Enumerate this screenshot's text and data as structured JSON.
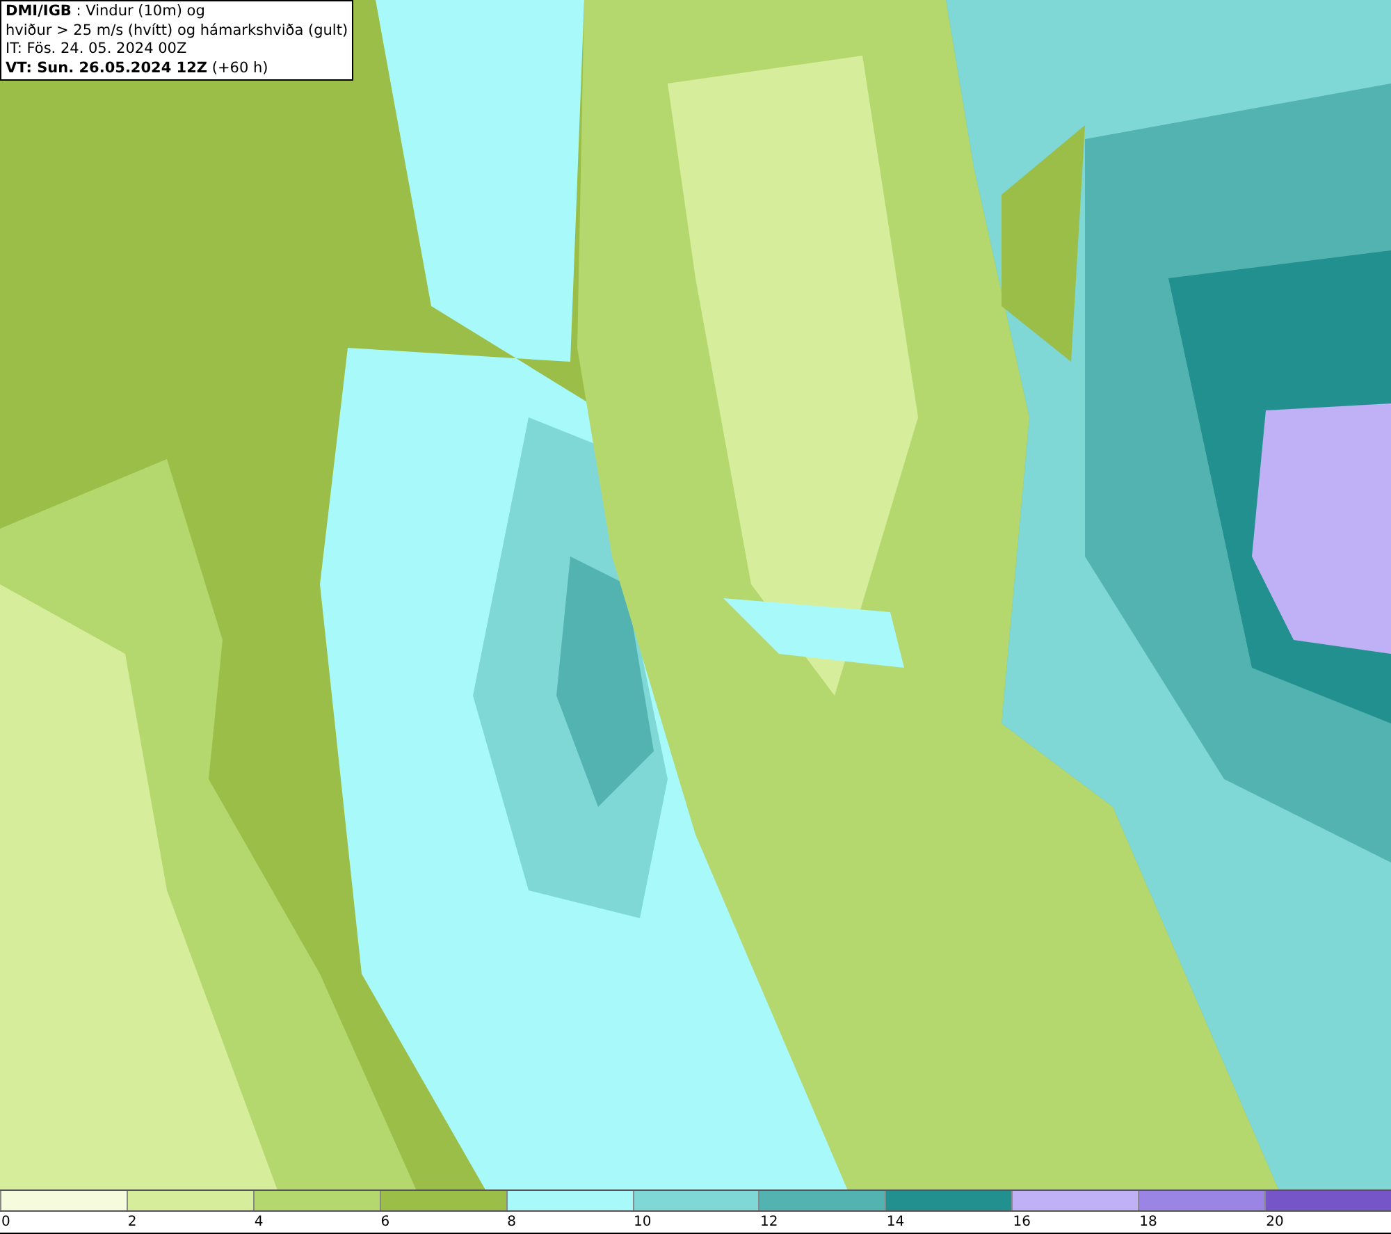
{
  "info_box": {
    "lines": [
      "**DMI/IGB** : Vindur (10m) og",
      "hviður > 25 m/s (hvítt) og hámarkshviða (gult)",
      "IT: Fös. 24. 05. 2024 00Z",
      "**VT: Sun. 26.05.2024 12Z** (+60 h)"
    ]
  },
  "legend": {
    "segments": [
      {
        "color": "#f5fbdc"
      },
      {
        "color": "#d6ee9c"
      },
      {
        "color": "#b5d86e"
      },
      {
        "color": "#9abe48"
      },
      {
        "color": "#a8fafa"
      },
      {
        "color": "#7fd8d6"
      },
      {
        "color": "#52b3b1"
      },
      {
        "color": "#22908e"
      },
      {
        "color": "#c0b0f5"
      },
      {
        "color": "#9a84e4"
      },
      {
        "color": "#7655c9"
      }
    ],
    "ticks": [
      "0",
      "2",
      "4",
      "6",
      "8",
      "10",
      "12",
      "14",
      "16",
      "18",
      "20"
    ]
  }
}
